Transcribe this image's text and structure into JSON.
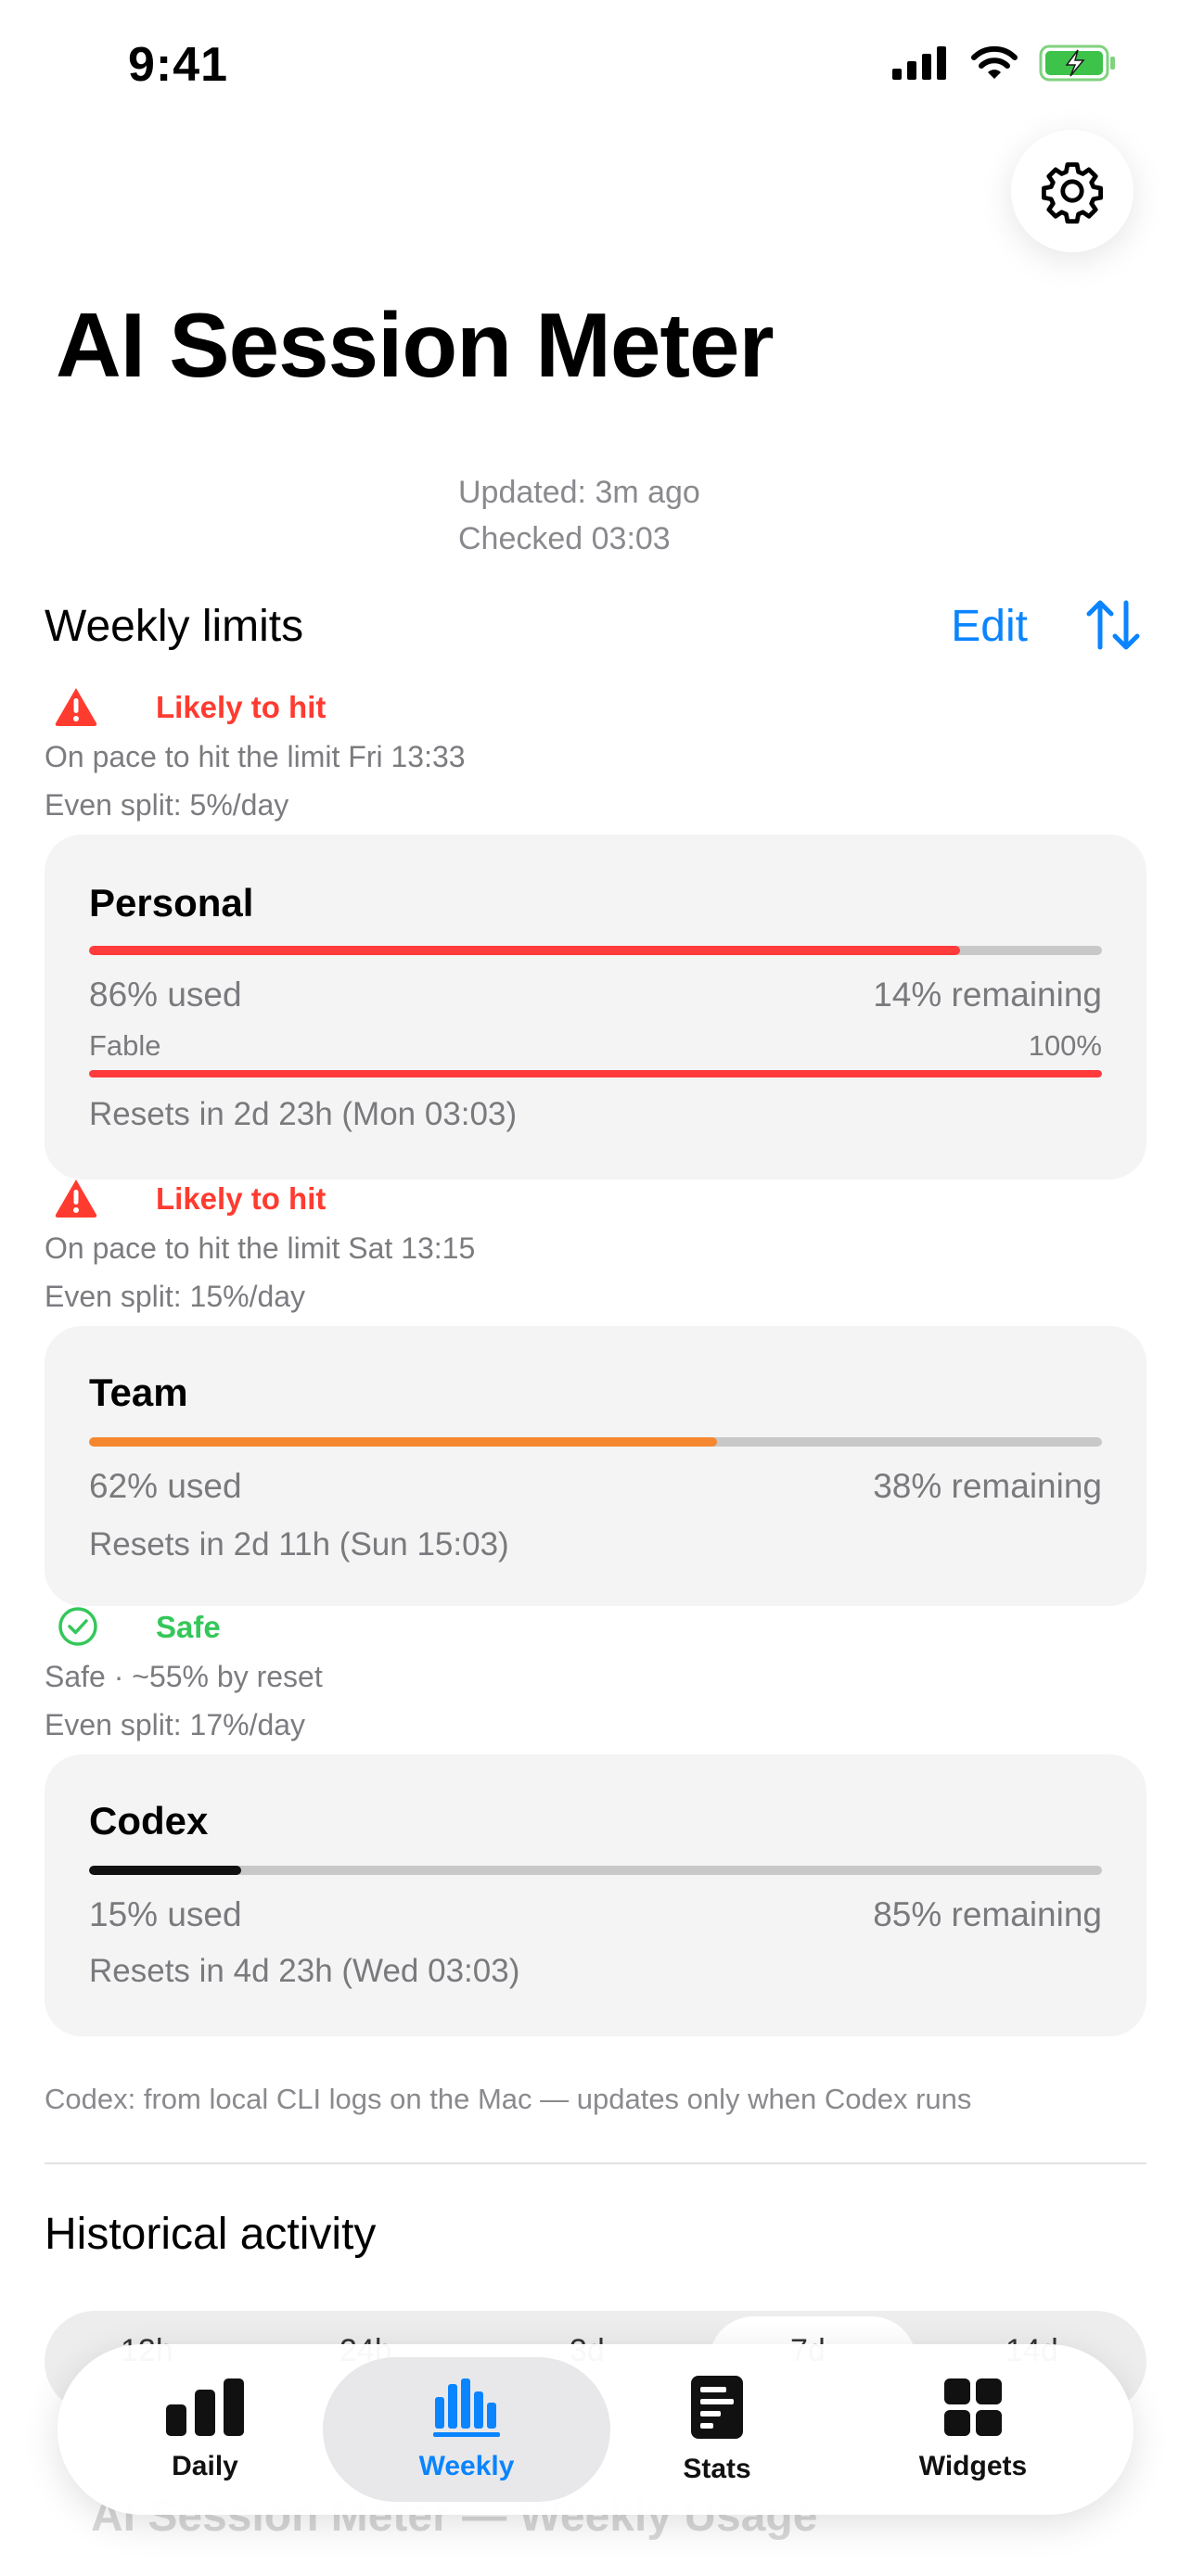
{
  "status_bar": {
    "time": "9:41"
  },
  "header": {
    "title": "AI Session Meter",
    "updated": "Updated: 3m ago",
    "checked": "Checked 03:03"
  },
  "weekly": {
    "section_title": "Weekly limits",
    "edit_label": "Edit",
    "limits": [
      {
        "status": "Likely to hit",
        "status_color": "#ff3b30",
        "pace_text": "On pace to hit the limit Fri 13:33",
        "even_split": "Even split: 5%/day",
        "name": "Personal",
        "used_fraction": 0.86,
        "bar_color": "#ff3b3b",
        "used_label": "86% used",
        "remaining_label": "14% remaining",
        "sub_model": "Fable",
        "sub_percent": "100%",
        "sub_fraction": 1.0,
        "reset": "Resets in 2d 23h (Mon 03:03)"
      },
      {
        "status": "Likely to hit",
        "status_color": "#ff3b30",
        "pace_text": "On pace to hit the limit Sat 13:15",
        "even_split": "Even split: 15%/day",
        "name": "Team",
        "used_fraction": 0.62,
        "bar_color": "#f5882f",
        "used_label": "62% used",
        "remaining_label": "38% remaining",
        "reset": "Resets in 2d 11h (Sun 15:03)"
      },
      {
        "status": "Safe",
        "status_color": "#34c759",
        "pace_text": "Safe · ~55% by reset",
        "even_split": "Even split: 17%/day",
        "name": "Codex",
        "used_fraction": 0.15,
        "bar_color": "#111111",
        "used_label": "15% used",
        "remaining_label": "85% remaining",
        "reset": "Resets in 4d 23h (Wed 03:03)"
      }
    ],
    "footnote": "Codex: from local CLI logs on the Mac — updates only when Codex runs"
  },
  "history": {
    "title": "Historical activity",
    "ranges": [
      "12h",
      "24h",
      "3d",
      "7d",
      "14d"
    ],
    "selected_range": "7d",
    "ghost_title": "AI Session Meter — Weekly Usage"
  },
  "tabs": [
    {
      "label": "Daily",
      "icon": "bar-chart-icon",
      "active": false
    },
    {
      "label": "Weekly",
      "icon": "weekly-bars-icon",
      "active": true
    },
    {
      "label": "Stats",
      "icon": "stats-doc-icon",
      "active": false
    },
    {
      "label": "Widgets",
      "icon": "widgets-grid-icon",
      "active": false
    }
  ],
  "colors": {
    "accent": "#0a84ff",
    "card_bg": "#f4f4f4",
    "danger": "#ff3b30",
    "safe": "#34c759"
  }
}
